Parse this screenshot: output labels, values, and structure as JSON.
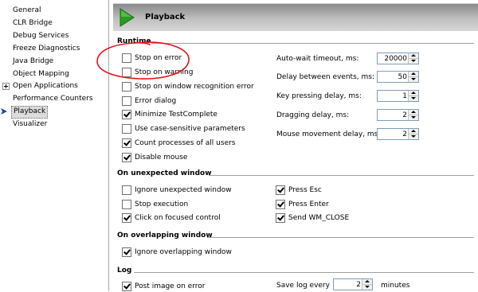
{
  "nav": {
    "items": [
      {
        "label": "General"
      },
      {
        "label": "CLR Bridge"
      },
      {
        "label": "Debug Services"
      },
      {
        "label": "Freeze Diagnostics"
      },
      {
        "label": "Java Bridge"
      },
      {
        "label": "Object Mapping"
      },
      {
        "label": "Open Applications"
      },
      {
        "label": "Performance Counters"
      },
      {
        "label": "Playback"
      },
      {
        "label": "Visualizer"
      }
    ],
    "selected": "Playback"
  },
  "header": {
    "title": "Playback",
    "icon": "play-icon"
  },
  "runtime": {
    "title": "Runtime",
    "checkboxes": [
      {
        "label": "Stop on error",
        "checked": false
      },
      {
        "label": "Stop on warning",
        "checked": false
      },
      {
        "label": "Stop on window recognition error",
        "checked": false
      },
      {
        "label": "Error dialog",
        "checked": false
      },
      {
        "label": "Minimize TestComplete",
        "checked": true
      },
      {
        "label": "Use case-sensitive parameters",
        "checked": false
      },
      {
        "label": "Count processes of all users",
        "checked": true
      },
      {
        "label": "Disable mouse",
        "checked": true
      }
    ],
    "fields": [
      {
        "label": "Auto-wait timeout, ms:",
        "value": "20000"
      },
      {
        "label": "Delay between events, ms:",
        "value": "50"
      },
      {
        "label": "Key pressing delay, ms:",
        "value": "1"
      },
      {
        "label": "Dragging delay, ms:",
        "value": "2"
      },
      {
        "label": "Mouse movement delay, ms:",
        "value": "2"
      }
    ]
  },
  "unexpected": {
    "title": "On unexpected window",
    "checkboxes": [
      {
        "label": "Ignore unexpected window",
        "checked": false
      },
      {
        "label": "Stop execution",
        "checked": false
      },
      {
        "label": "Click on focused control",
        "checked": true
      },
      {
        "label": "Press Esc",
        "checked": true
      },
      {
        "label": "Press Enter",
        "checked": true
      },
      {
        "label": "Send WM_CLOSE",
        "checked": true
      }
    ]
  },
  "overlapping": {
    "title": "On overlapping window",
    "checkboxes": [
      {
        "label": "Ignore overlapping window",
        "checked": true
      }
    ]
  },
  "log": {
    "title": "Log",
    "checkboxes": [
      {
        "label": "Post image on error",
        "checked": true
      }
    ],
    "save_label": "Save log every",
    "save_value": "2",
    "save_unit": "minutes"
  },
  "colors": {
    "annotation": "#e0141e",
    "header_icon": "#2a9c1f",
    "selection_arrow": "#1a3fb8"
  }
}
